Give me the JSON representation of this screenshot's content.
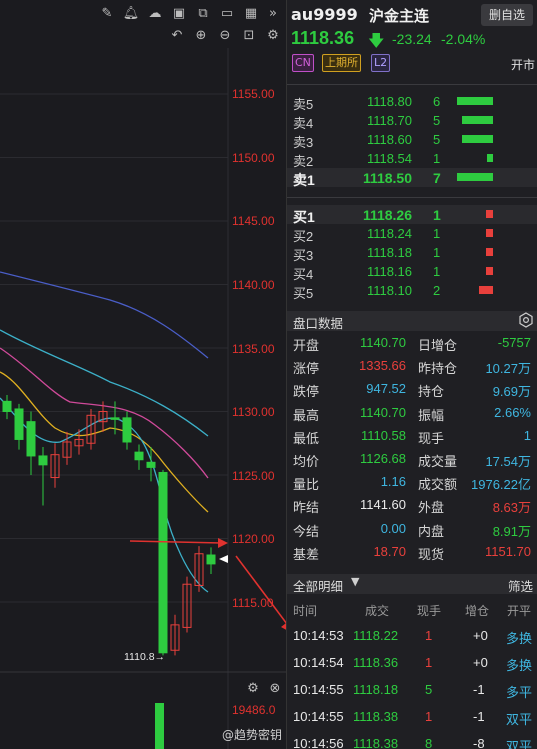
{
  "toolbar": {
    "icons_row1": [
      "edit-icon",
      "bell-icon",
      "cloud-icon",
      "camera-icon",
      "copy-icon",
      "monitor-icon",
      "grid-icon",
      "double-chevron-right-icon"
    ],
    "icons_row2": [
      "undo-icon",
      "zoom-in-icon",
      "zoom-out-icon",
      "compress-icon",
      "settings-icon"
    ]
  },
  "chart": {
    "price_axis": [
      "1155.00",
      "1150.00",
      "1145.00",
      "1140.00",
      "1135.00",
      "1130.00",
      "1125.00",
      "1120.00",
      "1115.00"
    ],
    "low_label": "1110.8→",
    "volume_axis_label": "19486.0",
    "bottom_icons": [
      "settings-icon",
      "close-icon"
    ],
    "colors": {
      "up": "#e8403c",
      "down": "#2ecc40",
      "ma_blue": "#4a5ec8",
      "ma_cyan": "#3cb0c8",
      "ma_pink": "#d04a9a",
      "ma_yellow": "#e0b020"
    }
  },
  "quote": {
    "code": "au9999",
    "name": "沪金主连",
    "custom_button": "删自选",
    "last": "1118.36",
    "change": "-23.24",
    "change_pct": "-2.04%",
    "tags": [
      "CN",
      "上期所",
      "L2"
    ],
    "status": "开市"
  },
  "asks": [
    {
      "label": "卖5",
      "price": "1118.80",
      "qty": "6",
      "level": 1.0
    },
    {
      "label": "卖4",
      "price": "1118.70",
      "qty": "5",
      "level": 0.87
    },
    {
      "label": "卖3",
      "price": "1118.60",
      "qty": "5",
      "level": 0.87
    },
    {
      "label": "卖2",
      "price": "1118.54",
      "qty": "1",
      "level": 0.16
    },
    {
      "label": "卖1",
      "price": "1118.50",
      "qty": "7",
      "level": 1.0
    }
  ],
  "bids": [
    {
      "label": "买1",
      "price": "1118.26",
      "qty": "1",
      "level": 0.2
    },
    {
      "label": "买2",
      "price": "1118.24",
      "qty": "1",
      "level": 0.2
    },
    {
      "label": "买3",
      "price": "1118.18",
      "qty": "1",
      "level": 0.2
    },
    {
      "label": "买4",
      "price": "1118.16",
      "qty": "1",
      "level": 0.2
    },
    {
      "label": "买5",
      "price": "1118.10",
      "qty": "2",
      "level": 0.4
    }
  ],
  "market_data": {
    "title": "盘口数据",
    "rows": [
      [
        {
          "k": "开盘",
          "v": "1140.70",
          "c": "green"
        },
        {
          "k": "日增仓",
          "v": "-5757",
          "c": "green"
        }
      ],
      [
        {
          "k": "涨停",
          "v": "1335.66",
          "c": "red"
        },
        {
          "k": "昨持仓",
          "v": "10.27万",
          "c": "blue"
        }
      ],
      [
        {
          "k": "跌停",
          "v": "947.52",
          "c": "blue"
        },
        {
          "k": "持仓",
          "v": "9.69万",
          "c": "blue"
        }
      ],
      [
        {
          "k": "最高",
          "v": "1140.70",
          "c": "green"
        },
        {
          "k": "振幅",
          "v": "2.66%",
          "c": "blue"
        }
      ],
      [
        {
          "k": "最低",
          "v": "1110.58",
          "c": "green"
        },
        {
          "k": "现手",
          "v": "1",
          "c": "blue"
        }
      ],
      [
        {
          "k": "均价",
          "v": "1126.68",
          "c": "green"
        },
        {
          "k": "成交量",
          "v": "17.54万",
          "c": "blue"
        }
      ],
      [
        {
          "k": "量比",
          "v": "1.16",
          "c": "blue"
        },
        {
          "k": "成交额",
          "v": "1976.22亿",
          "c": "blue"
        }
      ],
      [
        {
          "k": "昨结",
          "v": "1141.60",
          "c": "white"
        },
        {
          "k": "外盘",
          "v": "8.63万",
          "c": "red"
        }
      ],
      [
        {
          "k": "今结",
          "v": "0.00",
          "c": "blue"
        },
        {
          "k": "内盘",
          "v": "8.91万",
          "c": "green"
        }
      ],
      [
        {
          "k": "基差",
          "v": "18.70",
          "c": "red"
        },
        {
          "k": "现货",
          "v": "1151.70",
          "c": "red"
        }
      ]
    ]
  },
  "details": {
    "title": "全部明细",
    "filter": "筛选",
    "columns": [
      "时间",
      "成交",
      "现手",
      "增仓",
      "开平"
    ],
    "trades": [
      {
        "time": "10:14:53",
        "price": "1118.22",
        "qty": "1",
        "qty_color": "red",
        "oi": "+0",
        "type": "多换",
        "type_color": "blue"
      },
      {
        "time": "10:14:54",
        "price": "1118.36",
        "qty": "1",
        "qty_color": "red",
        "oi": "+0",
        "type": "多换",
        "type_color": "blue"
      },
      {
        "time": "10:14:55",
        "price": "1118.18",
        "qty": "5",
        "qty_color": "green",
        "oi": "-1",
        "type": "多平",
        "type_color": "green"
      },
      {
        "time": "10:14:55",
        "price": "1118.38",
        "qty": "1",
        "qty_color": "red",
        "oi": "-1",
        "type": "双平",
        "type_color": "blue"
      },
      {
        "time": "10:14:56",
        "price": "1118.38",
        "qty": "8",
        "qty_color": "green",
        "oi": "-8",
        "type": "双平",
        "type_color": "blue"
      }
    ]
  },
  "watermark": "@趋势密钥"
}
